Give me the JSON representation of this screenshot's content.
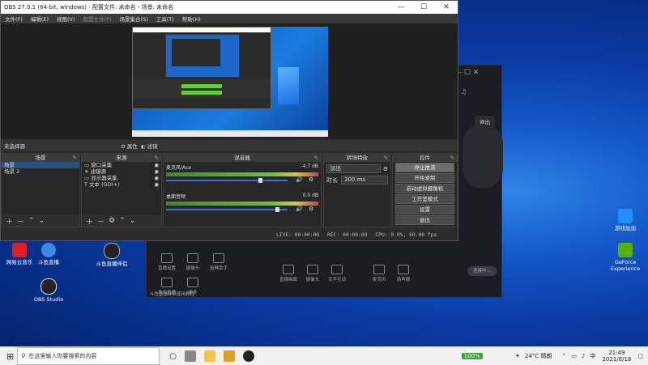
{
  "obs": {
    "title": "OBS 27.0.1 (64-bit, windows) - 配置文件: 未命名 - 场景: 未命名",
    "window_controls": [
      "—",
      "☐",
      "✕"
    ],
    "menu": [
      "文件(F)",
      "编辑(E)",
      "视图(V)",
      "配置文件(P)",
      "场景集合(S)",
      "工具(T)",
      "帮助(H)"
    ],
    "source_bar": {
      "no_source": "未选择源",
      "properties": "属性",
      "filters": "滤镜"
    },
    "scenes": {
      "header": "场景",
      "items": [
        "场景",
        "场景 2"
      ]
    },
    "sources": {
      "header": "来源",
      "items": [
        "窗口采集",
        "滤镜源",
        "显示器采集",
        "文本 (GDI+)"
      ]
    },
    "mixer": {
      "header": "混音器",
      "tracks": [
        {
          "name": "麦克风/Aux",
          "db": "-4.7 dB",
          "level": 0.76
        },
        {
          "name": "桌面音频",
          "db": "0.0 dB",
          "level": 0.9
        }
      ]
    },
    "transitions": {
      "header": "转场特效",
      "select": "淡出",
      "duration_label": "时长",
      "duration_value": "300 ms"
    },
    "controls": {
      "header": "控件",
      "buttons": [
        "停止推流",
        "开始录制",
        "启动虚拟摄像机",
        "工作室模式",
        "设置",
        "退出"
      ]
    },
    "status": {
      "live": "LIVE: 00:00:00",
      "rec": "REC: 00:00:00",
      "cpu": "CPU: 0.9%, 60.00 fps"
    }
  },
  "back_app": {
    "exit_label": "退出",
    "top_icons": [
      "直播设置",
      "摄像头",
      "投屏助手"
    ],
    "bottom_left": [
      "音乐直播",
      "更多"
    ],
    "mid_icons": [
      "直播画面",
      "摄像头",
      "文字互动",
      "麦克风",
      "扬声器"
    ],
    "bottom_note": "斗鱼直播伴侣使用教程",
    "start_btn": "连接中..."
  },
  "desktop": {
    "icons": [
      {
        "label": "网易云音乐",
        "color": "#e02020"
      },
      {
        "label": "斗鱼直播",
        "color": "#3c8ae0"
      },
      {
        "label": "斗鱼直播伴侣",
        "color": "#222222"
      },
      {
        "label": "OBS Studio",
        "color": "#222222"
      },
      {
        "label": "游戏加加",
        "color": "#1e90ff"
      },
      {
        "label": "GeForce Experience",
        "color": "#5ab000"
      }
    ]
  },
  "taskbar": {
    "search_placeholder": "在这里输入你要搜索的内容",
    "weather": "24°C 晴朗",
    "ime": "中",
    "time": "21:49",
    "date": "2021/8/18",
    "battery": "100%"
  }
}
